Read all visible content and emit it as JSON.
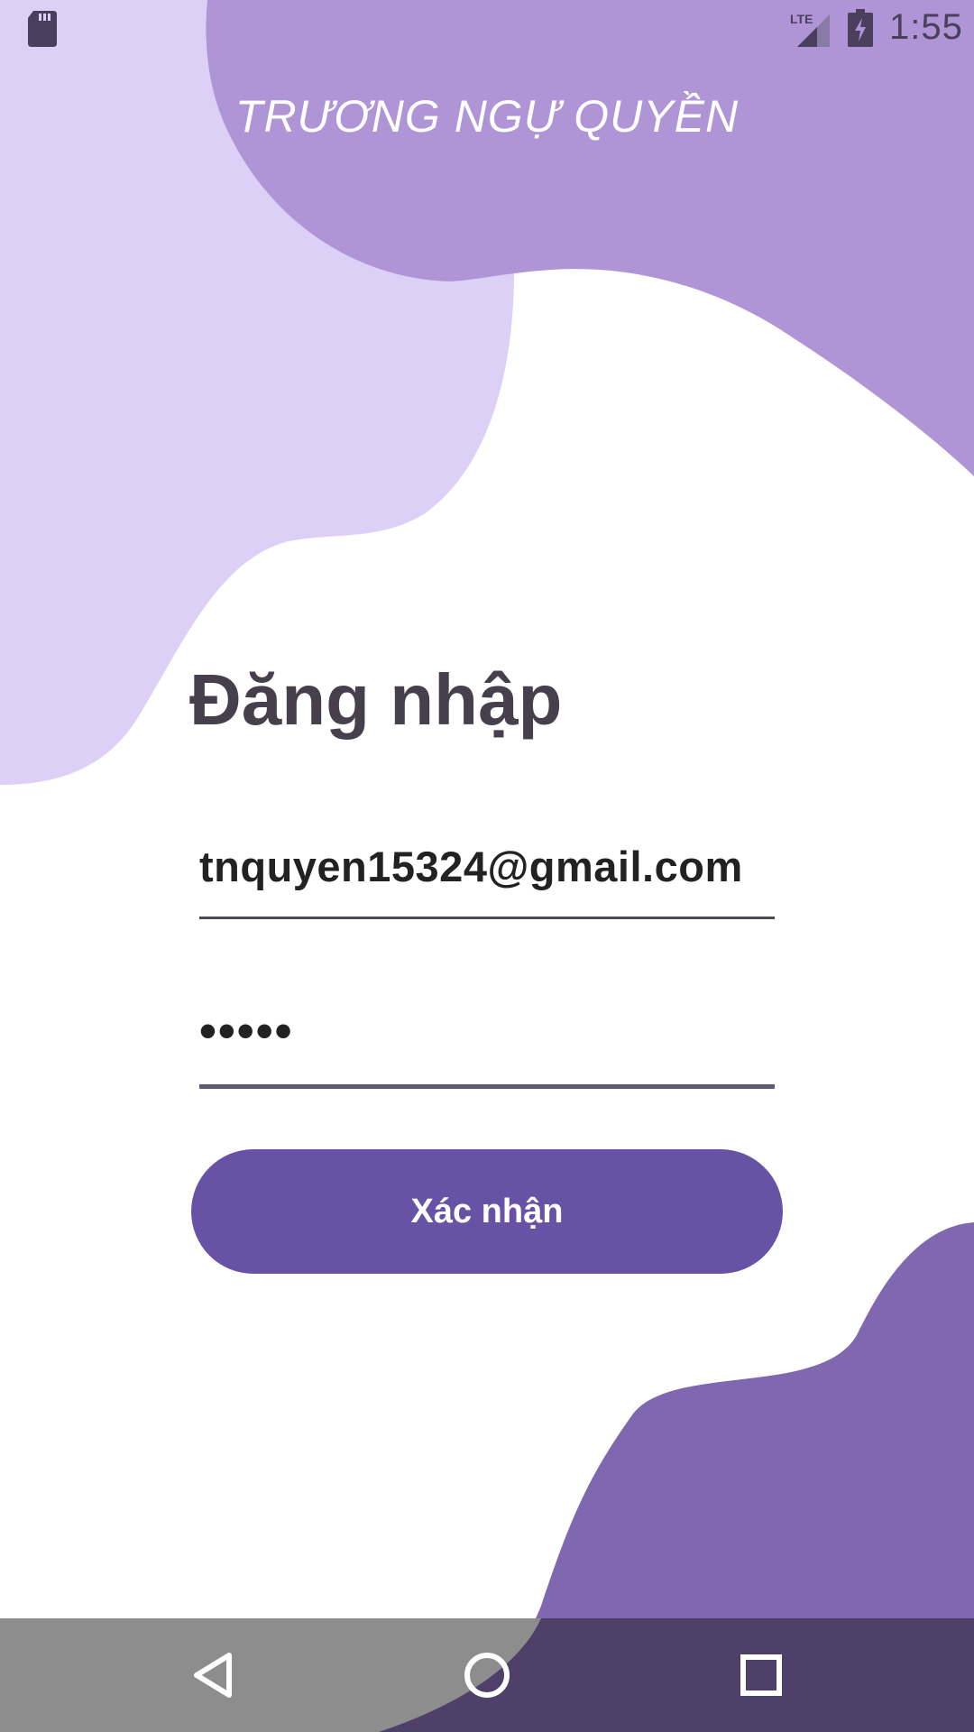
{
  "status_bar": {
    "time": "1:55",
    "network_label": "LTE",
    "icons": [
      "sd-card-icon",
      "lte-signal-icon",
      "battery-charging-icon"
    ]
  },
  "header": {
    "app_title": "TRƯƠNG NGỰ QUYỀN"
  },
  "login": {
    "title": "Đăng nhập",
    "email_value": "tnquyen15324@gmail.com",
    "password_display": "•••••",
    "confirm_label": "Xác nhận"
  },
  "nav_bar": {
    "icons": [
      "back-icon",
      "home-icon",
      "recents-icon"
    ]
  },
  "colors": {
    "blob_light": "#ddd0f6",
    "blob_mid": "#b095d6",
    "blob_dark": "#8068b1",
    "button": "#6852a5",
    "nav_bar_gray": "#8d8d8d",
    "nav_bar_purple": "#4e4068",
    "title_text": "#46404d"
  }
}
